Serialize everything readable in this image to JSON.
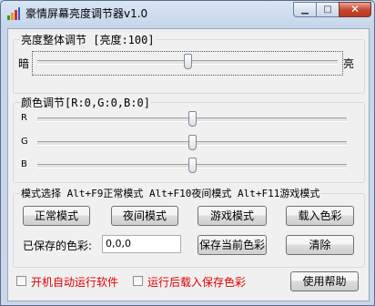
{
  "window": {
    "title": "豪情屏幕亮度调节器v1.0",
    "icon": "bar-chart-icon",
    "controls": {
      "minimize": "minimize-icon",
      "maximize": "maximize-icon",
      "close": "close-icon"
    }
  },
  "brightness": {
    "legend": "亮度整体调节 [亮度:100]",
    "dark_label": "暗",
    "bright_label": "亮",
    "value": 100,
    "level": 0.5
  },
  "color": {
    "legend": "颜色调节[R:0,G:0,B:0]",
    "channels": [
      {
        "label": "R",
        "value": 0,
        "level": 0.5
      },
      {
        "label": "G",
        "value": 0,
        "level": 0.5
      },
      {
        "label": "B",
        "value": 0,
        "level": 0.5
      }
    ]
  },
  "mode": {
    "legend": "模式选择 Alt+F9正常模式 Alt+F10夜间模式 Alt+F11游戏模式",
    "normal": "正常模式",
    "night": "夜间模式",
    "game": "游戏模式",
    "load": "载入色彩",
    "saved_label": "已保存的色彩:",
    "saved_value": "0,0,0",
    "save": "保存当前色彩",
    "clear": "清除"
  },
  "options": {
    "autostart": "开机自动运行软件",
    "load_after_run": "运行后载入保存色彩",
    "autostart_checked": false,
    "load_after_run_checked": false,
    "option_color": "#e00000"
  },
  "help": "使用帮助"
}
